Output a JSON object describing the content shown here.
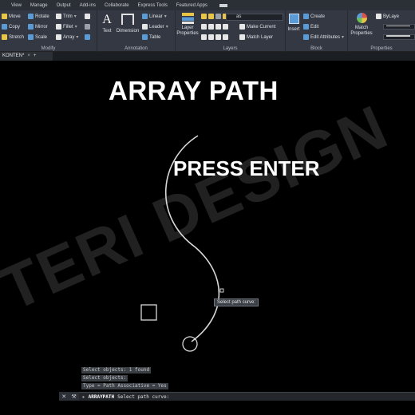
{
  "menu": [
    "View",
    "Manage",
    "Output",
    "Add-ins",
    "Collaborate",
    "Express Tools",
    "Featured Apps"
  ],
  "modify": {
    "title": "Modify",
    "items": [
      "Move",
      "Rotate",
      "Trim",
      "Copy",
      "Mirror",
      "Fillet",
      "Stretch",
      "Scale",
      "Array"
    ]
  },
  "annotation": {
    "title": "Annotation",
    "text": "Text",
    "dimension": "Dimension",
    "linear": "Linear",
    "leader": "Leader",
    "table": "Table"
  },
  "layers": {
    "title": "Layers",
    "layer_properties": "Layer Properties",
    "current_layer": "as",
    "make_current": "Make Current",
    "match_layer": "Match Layer"
  },
  "block": {
    "title": "Block",
    "insert": "Insert",
    "create": "Create",
    "edit": "Edit",
    "edit_attributes": "Edit Attributes"
  },
  "properties": {
    "title": "Properties",
    "match_properties": "Match Properties",
    "bylayer": "ByLaye"
  },
  "file_tab": {
    "name": "KONTEN*",
    "close": "×",
    "add": "+"
  },
  "canvas": {
    "title": "ARRAY PATH",
    "instruction": "PRESS ENTER",
    "tooltip": "Select path curve:",
    "watermark": "TERI DESIGN"
  },
  "command": {
    "history": [
      "Select objects: 1 found",
      "Select objects:",
      "Type = Path  Associative = Yes"
    ],
    "current_name": "ARRAYPATH",
    "current_prompt": "Select path curve:"
  },
  "colors": {
    "ribbon": "#333842",
    "canvas": "#000000",
    "menubar": "#2b2f36"
  }
}
